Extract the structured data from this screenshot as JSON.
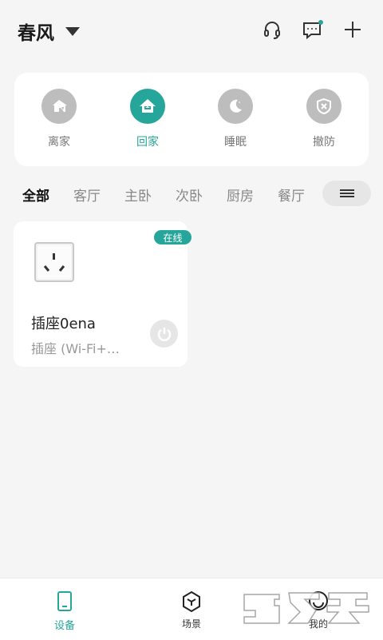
{
  "header": {
    "home_name": "春风",
    "icons": [
      "headset-icon",
      "message-icon",
      "plus-icon"
    ],
    "message_dot_color": "#26a69a"
  },
  "modes": [
    {
      "label": "离家",
      "icon": "leave-home-icon",
      "active": false
    },
    {
      "label": "回家",
      "icon": "return-home-icon",
      "active": true
    },
    {
      "label": "睡眠",
      "icon": "moon-icon",
      "active": false
    },
    {
      "label": "撤防",
      "icon": "disarm-shield-icon",
      "active": false
    }
  ],
  "rooms": {
    "tabs": [
      "全部",
      "客厅",
      "主卧",
      "次卧",
      "厨房",
      "餐厅"
    ],
    "selected": "全部"
  },
  "device": {
    "name": "插座0ena",
    "type": "插座 (Wi-Fi+…",
    "status": "在线",
    "power_on": false
  },
  "nav": {
    "items": [
      {
        "label": "设备",
        "icon": "device-icon",
        "active": true
      },
      {
        "label": "场景",
        "icon": "scene-cube-icon",
        "active": false
      },
      {
        "label": "我的",
        "icon": "profile-icon",
        "active": false
      }
    ]
  },
  "watermark": "吾爱破解 logo",
  "colors": {
    "accent": "#26a69a",
    "inactive_mode": "#bdbdbd",
    "background": "#f5f5f5"
  }
}
